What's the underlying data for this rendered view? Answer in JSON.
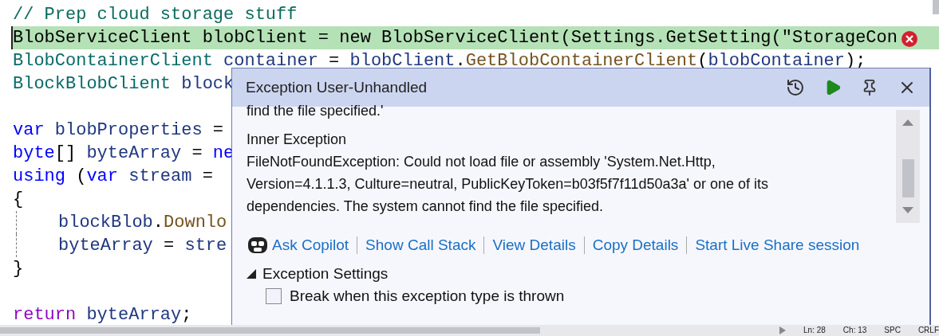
{
  "editor": {
    "lines": [
      {
        "tokens": [
          {
            "kind": "comment",
            "text": "// Prep cloud storage stuff"
          }
        ]
      },
      {
        "current": true,
        "tokens": [
          {
            "kind": "plain",
            "text": "BlobServiceClient blobClient = new BlobServiceClient(Settings.GetSetting(\"StorageCon"
          }
        ]
      },
      {
        "tokens": [
          {
            "kind": "type",
            "text": "BlobContainerClient"
          },
          {
            "kind": "ident",
            "text": " container "
          },
          {
            "kind": "plain",
            "text": "= "
          },
          {
            "kind": "ident",
            "text": "blobClient"
          },
          {
            "kind": "plain",
            "text": "."
          },
          {
            "kind": "method",
            "text": "GetBlobContainerClient"
          },
          {
            "kind": "plain",
            "text": "("
          },
          {
            "kind": "ident",
            "text": "blobContainer"
          },
          {
            "kind": "plain",
            "text": ");"
          }
        ]
      },
      {
        "tokens": [
          {
            "kind": "type",
            "text": "BlockBlobClient"
          },
          {
            "kind": "ident",
            "text": " block"
          }
        ]
      },
      {
        "spaced": true,
        "tokens": [
          {
            "kind": "keyword",
            "text": "var"
          },
          {
            "kind": "ident",
            "text": " blobProperties "
          },
          {
            "kind": "plain",
            "text": "="
          }
        ]
      },
      {
        "tokens": [
          {
            "kind": "keyword",
            "text": "byte"
          },
          {
            "kind": "plain",
            "text": "[] "
          },
          {
            "kind": "ident",
            "text": "byteArray "
          },
          {
            "kind": "plain",
            "text": "= "
          },
          {
            "kind": "keyword",
            "text": "ne"
          }
        ]
      },
      {
        "tokens": [
          {
            "kind": "keyword",
            "text": "using"
          },
          {
            "kind": "plain",
            "text": " ("
          },
          {
            "kind": "keyword",
            "text": "var"
          },
          {
            "kind": "ident",
            "text": " stream "
          },
          {
            "kind": "plain",
            "text": "="
          }
        ]
      },
      {
        "tokens": [
          {
            "kind": "plain",
            "text": "{"
          }
        ]
      },
      {
        "indent": true,
        "tokens": [
          {
            "kind": "ident",
            "text": "blockBlob"
          },
          {
            "kind": "plain",
            "text": "."
          },
          {
            "kind": "method",
            "text": "Downlo"
          }
        ]
      },
      {
        "indent": true,
        "tokens": [
          {
            "kind": "ident",
            "text": "byteArray "
          },
          {
            "kind": "plain",
            "text": "= "
          },
          {
            "kind": "ident",
            "text": "stre"
          }
        ]
      },
      {
        "tokens": [
          {
            "kind": "plain",
            "text": "}"
          }
        ]
      },
      {
        "spaced": true,
        "tokens": [
          {
            "kind": "control",
            "text": "return"
          },
          {
            "kind": "ident",
            "text": " byteArray"
          },
          {
            "kind": "plain",
            "text": ";"
          }
        ]
      }
    ]
  },
  "popup": {
    "title": "Exception User-Unhandled",
    "cut_text": "find the file specified.'",
    "heading": "Inner Exception",
    "message": "FileNotFoundException: Could not load file or assembly 'System.Net.Http, Version=4.1.1.3, Culture=neutral, PublicKeyToken=b03f5f7f11d50a3a' or one of its dependencies. The system cannot find the file specified.",
    "links": [
      "Ask Copilot",
      "Show Call Stack",
      "View Details",
      "Copy Details",
      "Start Live Share session"
    ],
    "settings": {
      "label": "Exception Settings",
      "expanded": true,
      "options": [
        {
          "label": "Break when this exception type is thrown",
          "checked": false
        }
      ]
    }
  },
  "status_bar": [
    "Ln: 28",
    "Ch: 13",
    "SPC",
    "CRLF"
  ]
}
